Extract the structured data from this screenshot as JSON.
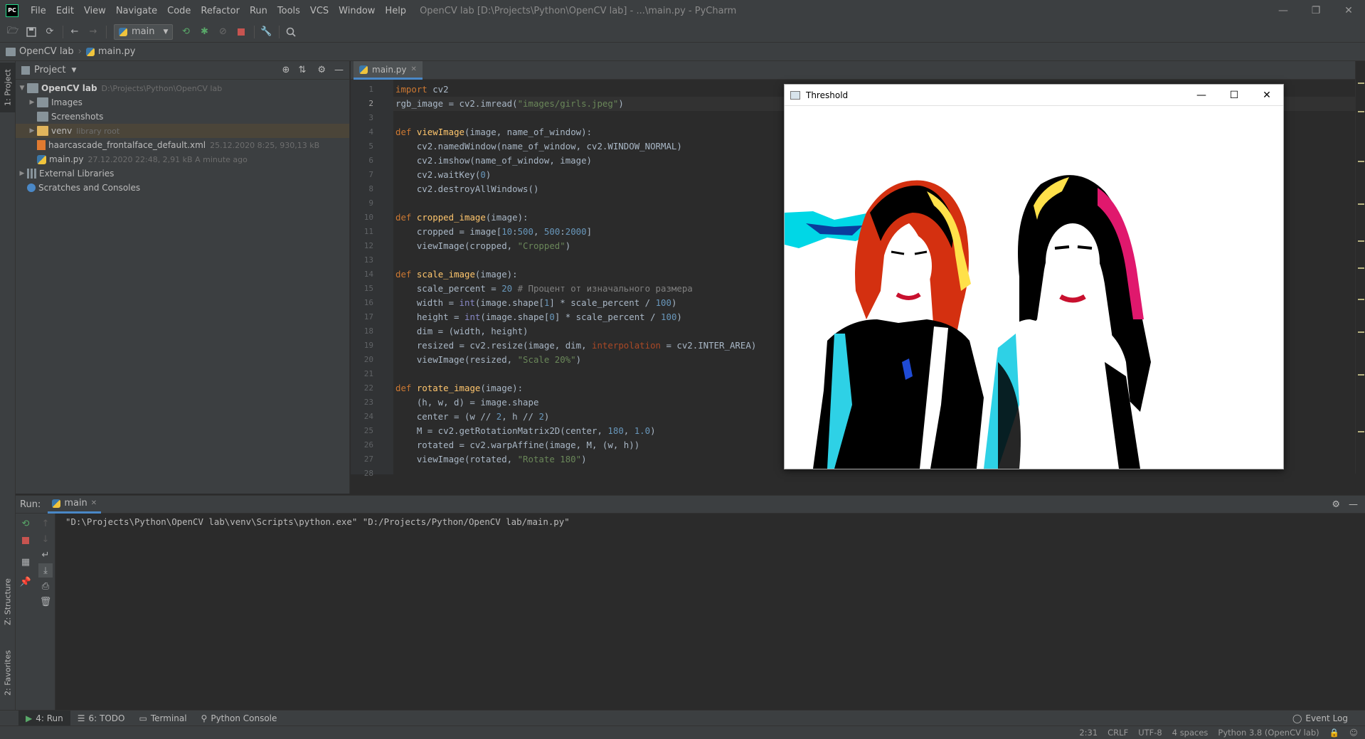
{
  "menubar": {
    "logo": "PC",
    "items": [
      "File",
      "Edit",
      "View",
      "Navigate",
      "Code",
      "Refactor",
      "Run",
      "Tools",
      "VCS",
      "Window",
      "Help"
    ],
    "window_title": "OpenCV lab [D:\\Projects\\Python\\OpenCV lab] - ...\\main.py - PyCharm"
  },
  "toolbar": {
    "run_config": "main"
  },
  "breadcrumb": {
    "project": "OpenCV lab",
    "file": "main.py"
  },
  "left_strip": {
    "project_tab": "1: Project",
    "structure_tab": "Z: Structure",
    "favorites_tab": "2: Favorites"
  },
  "project_panel": {
    "title": "Project",
    "tree": [
      {
        "label": "OpenCV lab",
        "hint": "D:\\Projects\\Python\\OpenCV lab",
        "type": "folder",
        "depth": 0,
        "expanded": true
      },
      {
        "label": "Images",
        "hint": "",
        "type": "folder",
        "depth": 1,
        "expanded": false
      },
      {
        "label": "Screenshots",
        "hint": "",
        "type": "folder",
        "depth": 1,
        "expanded": null
      },
      {
        "label": "venv",
        "hint": "library root",
        "type": "folder-excluded",
        "depth": 1,
        "expanded": false
      },
      {
        "label": "haarcascade_frontalface_default.xml",
        "hint": "25.12.2020 8:25, 930,13 kB",
        "type": "xml",
        "depth": 1,
        "expanded": null
      },
      {
        "label": "main.py",
        "hint": "27.12.2020 22:48, 2,91 kB A minute ago",
        "type": "py",
        "depth": 1,
        "expanded": null
      },
      {
        "label": "External Libraries",
        "hint": "",
        "type": "libs",
        "depth": 0,
        "expanded": false
      },
      {
        "label": "Scratches and Consoles",
        "hint": "",
        "type": "scratch",
        "depth": 0,
        "expanded": null
      }
    ]
  },
  "editor": {
    "tab_label": "main.py",
    "line_numbers": [
      "1",
      "2",
      "3",
      "4",
      "5",
      "6",
      "7",
      "8",
      "9",
      "10",
      "11",
      "12",
      "13",
      "14",
      "15",
      "16",
      "17",
      "18",
      "19",
      "20",
      "21",
      "22",
      "23",
      "24",
      "25",
      "26",
      "27",
      "28"
    ],
    "lines": [
      "import cv2",
      "rgb_image = cv2.imread(\"images/girls.jpeg\")",
      "",
      "def viewImage(image, name_of_window):",
      "    cv2.namedWindow(name_of_window, cv2.WINDOW_NORMAL)",
      "    cv2.imshow(name_of_window, image)",
      "    cv2.waitKey(0)",
      "    cv2.destroyAllWindows()",
      "",
      "def cropped_image(image):",
      "    cropped = image[10:500, 500:2000]",
      "    viewImage(cropped, \"Cropped\")",
      "",
      "def scale_image(image):",
      "    scale_percent = 20 # Процент от изначального размера",
      "    width = int(image.shape[1] * scale_percent / 100)",
      "    height = int(image.shape[0] * scale_percent / 100)",
      "    dim = (width, height)",
      "    resized = cv2.resize(image, dim, interpolation = cv2.INTER_AREA)",
      "    viewImage(resized, \"Scale 20%\")",
      "",
      "def rotate_image(image):",
      "    (h, w, d) = image.shape",
      "    center = (w // 2, h // 2)",
      "    M = cv2.getRotationMatrix2D(center, 180, 1.0)",
      "    rotated = cv2.warpAffine(image, M, (w, h))",
      "    viewImage(rotated, \"Rotate 180\")",
      ""
    ]
  },
  "threshold_window": {
    "title": "Threshold"
  },
  "run_panel": {
    "label": "Run:",
    "tab": "main",
    "console_output": "\"D:\\Projects\\Python\\OpenCV lab\\venv\\Scripts\\python.exe\" \"D:/Projects/Python/OpenCV lab/main.py\""
  },
  "toolwindow_bar": {
    "run": "4: Run",
    "todo": "6: TODO",
    "terminal": "Terminal",
    "python_console": "Python Console",
    "event_log": "Event Log"
  },
  "status_bar": {
    "position": "2:31",
    "line_separator": "CRLF",
    "encoding": "UTF-8",
    "indent": "4 spaces",
    "interpreter": "Python 3.8 (OpenCV lab)"
  },
  "colors": {
    "accent": "#4a88c7",
    "panel_bg": "#3c3f41",
    "editor_bg": "#2b2b2b"
  }
}
